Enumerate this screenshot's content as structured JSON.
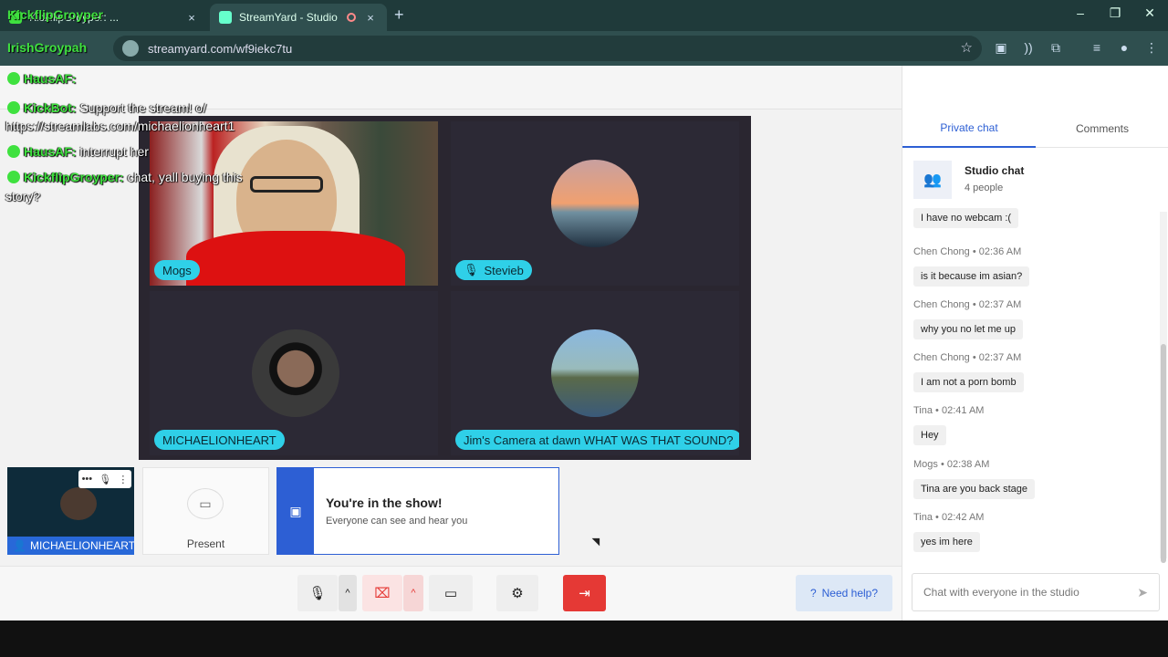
{
  "browser": {
    "tabs": [
      {
        "title": "KickflipGroyper: ...",
        "active": false
      },
      {
        "title": "StreamYard - Studio",
        "active": true
      }
    ],
    "url": "streamyard.com/wf9iekc7tu",
    "new_tab": "+",
    "close": "×",
    "star": "☆"
  },
  "overlay": {
    "top_left_user": "KickflipGroyper",
    "addr_user": "IrishGroypah",
    "lines": [
      {
        "user": "HausAF:",
        "text": ""
      },
      {
        "user": "KickBot:",
        "text": "Support the stream! o/"
      },
      {
        "user": "",
        "text": "https://streamlabs.com/michaelionheart1"
      },
      {
        "user": "HausAF:",
        "text": "interrupt her"
      },
      {
        "user": "KickflipGroyper:",
        "text": "chat, yall buying this"
      },
      {
        "user": "",
        "text": "story?"
      }
    ]
  },
  "stage": {
    "tiles": [
      {
        "name": "Mogs",
        "muted": false
      },
      {
        "name": "Stevieb",
        "muted": true
      },
      {
        "name": "MICHAELIONHEART",
        "muted": false
      },
      {
        "name": "Jim's Camera at dawn WHAT WAS THAT SOUND?",
        "muted": false
      }
    ]
  },
  "self": {
    "label": "MICHAELIONHEART"
  },
  "present": {
    "label": "Present"
  },
  "inshow": {
    "title": "You're in the show!",
    "subtitle": "Everyone can see and hear you"
  },
  "toolbar": {
    "help_label": "Need help?"
  },
  "panel": {
    "tabs": [
      "Private chat",
      "Comments"
    ],
    "studio_title": "Studio chat",
    "studio_sub": "4 people",
    "messages": [
      {
        "author": "",
        "time": "",
        "text": "I have no webcam :("
      },
      {
        "author": "Chen Chong",
        "time": "02:36 AM",
        "text": "is it because im asian?"
      },
      {
        "author": "Chen Chong",
        "time": "02:37 AM",
        "text": "why you no let me up"
      },
      {
        "author": "Chen Chong",
        "time": "02:37 AM",
        "text": "I am not a porn bomb"
      },
      {
        "author": "Tina",
        "time": "02:41 AM",
        "text": "Hey"
      },
      {
        "author": "Mogs",
        "time": "02:38 AM",
        "text": "Tina are you back stage"
      },
      {
        "author": "Tina",
        "time": "02:42 AM",
        "text": "yes im here"
      }
    ],
    "input_placeholder": "Chat with everyone in the studio"
  },
  "colors": {
    "accent": "#2d5fd4",
    "name_tag": "#2fd0e8",
    "leave": "#e53935"
  }
}
